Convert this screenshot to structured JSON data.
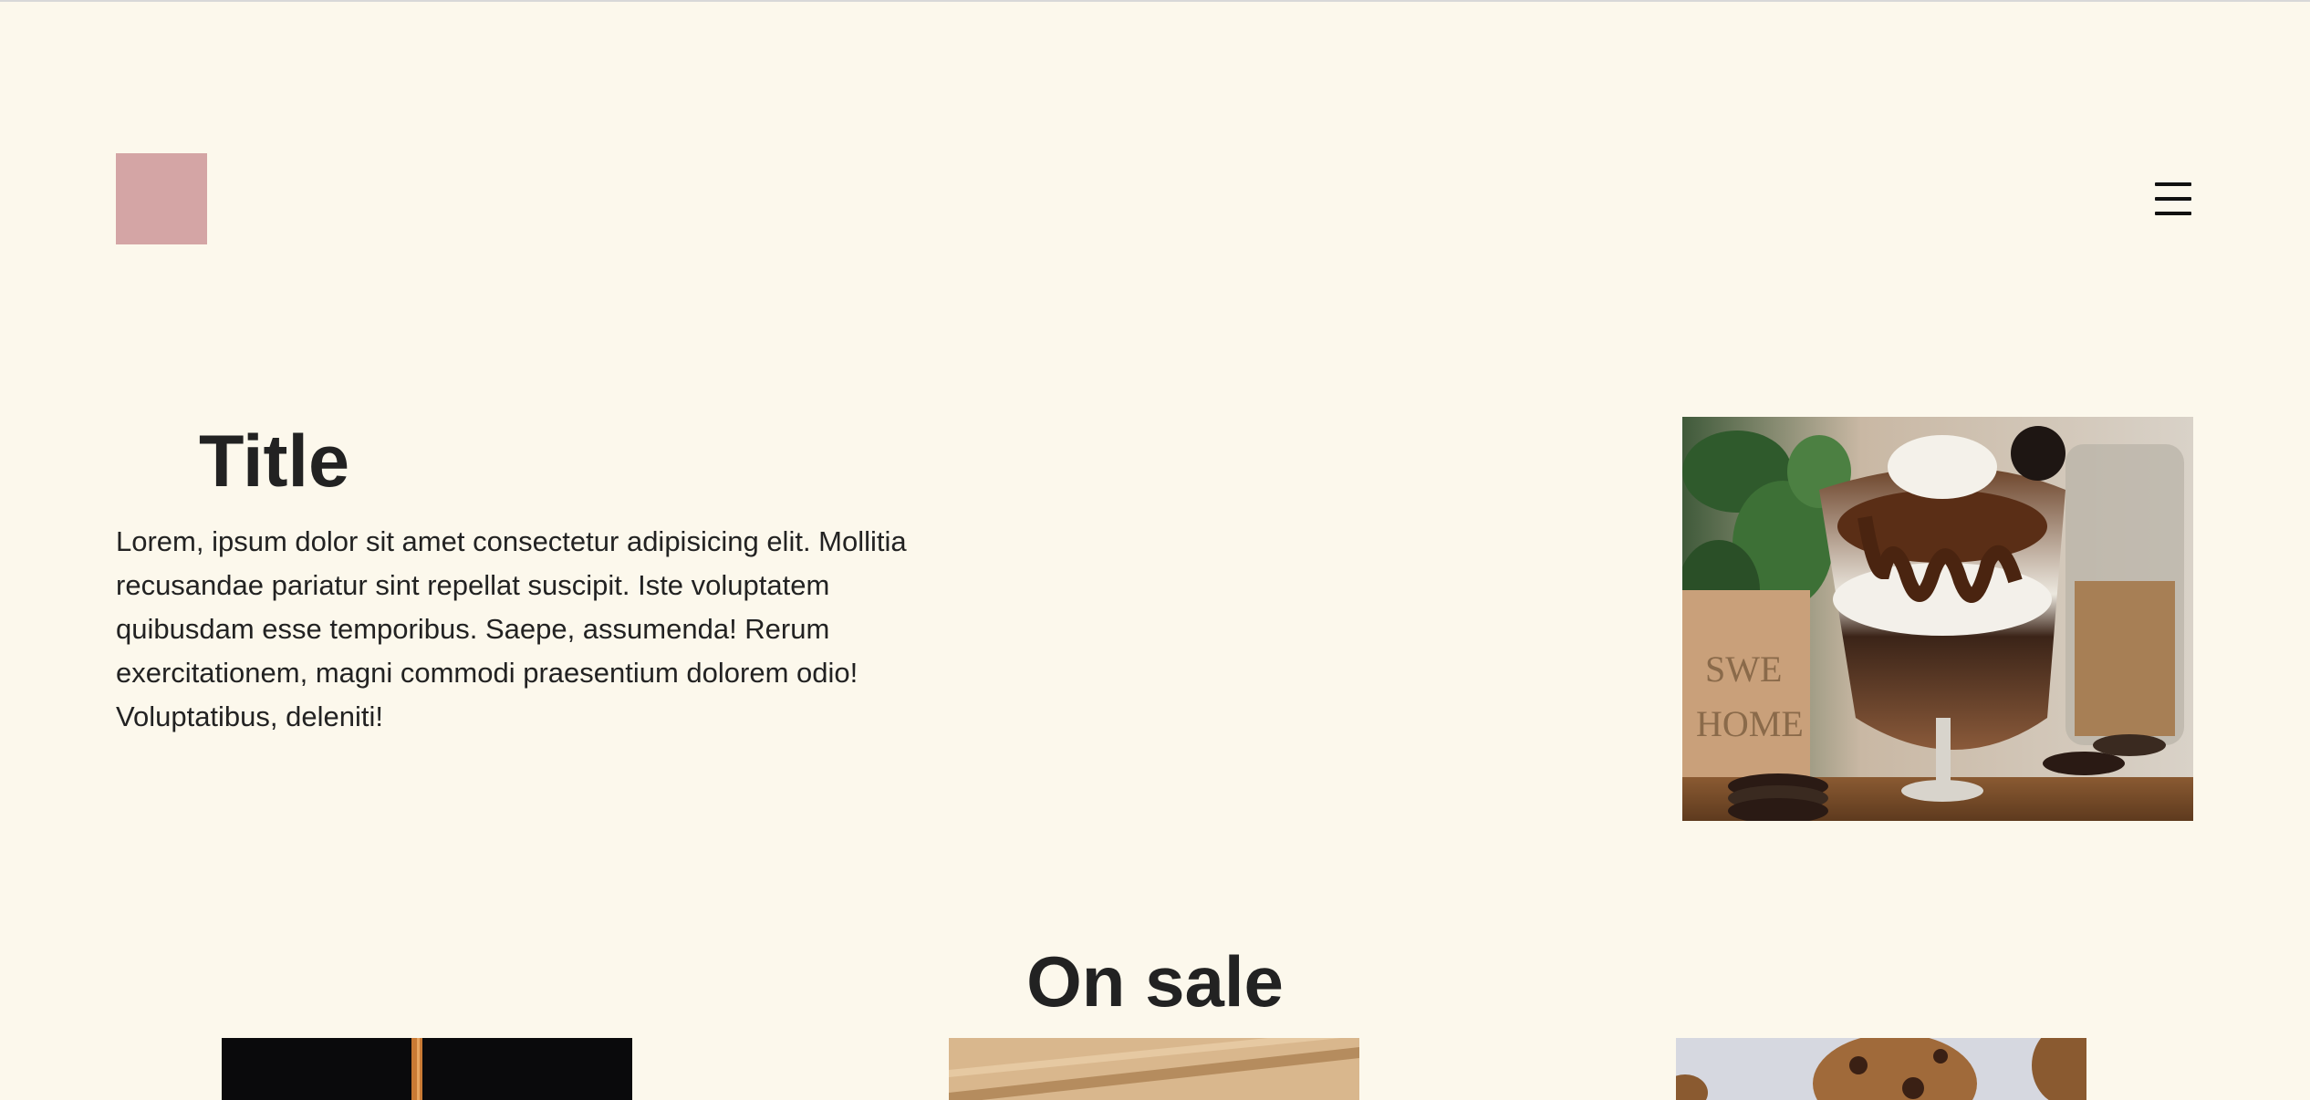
{
  "header": {
    "logo_icon": "logo-placeholder",
    "menu_icon": "hamburger-icon",
    "logo_color": "#d4a5a5"
  },
  "hero": {
    "title": "Title",
    "description": "Lorem, ipsum dolor sit amet consectetur adipisicing elit. Mollitia recusandae pariatur sint repellat suscipit. Iste voluptatem quibusdam esse temporibus. Saepe, assumenda! Rerum exercitationem, magni commodi praesentium dolorem odio! Voluptatibus, deleniti!",
    "image_subject": "chocolate-oreo-parfait-photo"
  },
  "on_sale": {
    "title": "On sale",
    "products": [
      {
        "image_subject": "dark-product-photo"
      },
      {
        "image_subject": "wooden-board-photo"
      },
      {
        "image_subject": "chocolate-chip-cookies-photo"
      }
    ]
  },
  "colors": {
    "background": "#fcf8ec",
    "text": "#222222",
    "logo": "#d4a5a5"
  }
}
